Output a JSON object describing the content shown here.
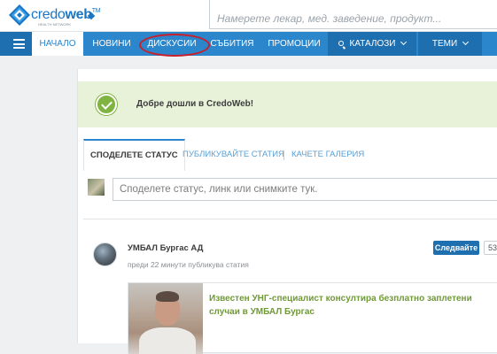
{
  "header": {
    "logo": {
      "text_primary": "credo",
      "text_secondary": "web",
      "tm": "TM",
      "tagline": "HEALTH NETWORK"
    },
    "search": {
      "placeholder": "Намерете лекар, мед. заведение, продукт..."
    }
  },
  "nav": {
    "items": [
      {
        "label": "НАЧАЛО",
        "active": true
      },
      {
        "label": "НОВИНИ"
      },
      {
        "label": "ДИСКУСИИ",
        "highlighted": true
      },
      {
        "label": "СЪБИТИЯ"
      },
      {
        "label": "ПРОМОЦИИ"
      },
      {
        "label": "КАТАЛОЗИ",
        "icon": "search-icon",
        "dropdown": true
      },
      {
        "label": "ТЕМИ",
        "dropdown": true
      }
    ]
  },
  "welcome": {
    "message": "Добре дошли в CredoWeb!"
  },
  "composer": {
    "tabs": [
      {
        "label": "СПОДЕЛЕТЕ СТАТУС",
        "active": true
      },
      {
        "label": "ПУБЛИКУВАЙТЕ СТАТИЯ"
      },
      {
        "label": "КАЧЕТЕ ГАЛЕРИЯ"
      }
    ],
    "input_placeholder": "Споделете статус, линк или снимките тук."
  },
  "feed": {
    "post": {
      "author": "УМБАЛ Бургас АД",
      "meta": "преди 22 минути публикува статия",
      "follow_label": "Следвайте",
      "follow_count": "53",
      "article_title": "Известен УНГ-специалист консултира безплатно заплетени случаи в УМБАЛ Бургас"
    }
  },
  "colors": {
    "brand_blue": "#2b86cc",
    "brand_dark_blue": "#1e6fb0",
    "success_green": "#80b441",
    "welcome_bg": "#e8f2d9",
    "article_title_green": "#6f9a36",
    "annotation_red": "#c8202a"
  }
}
